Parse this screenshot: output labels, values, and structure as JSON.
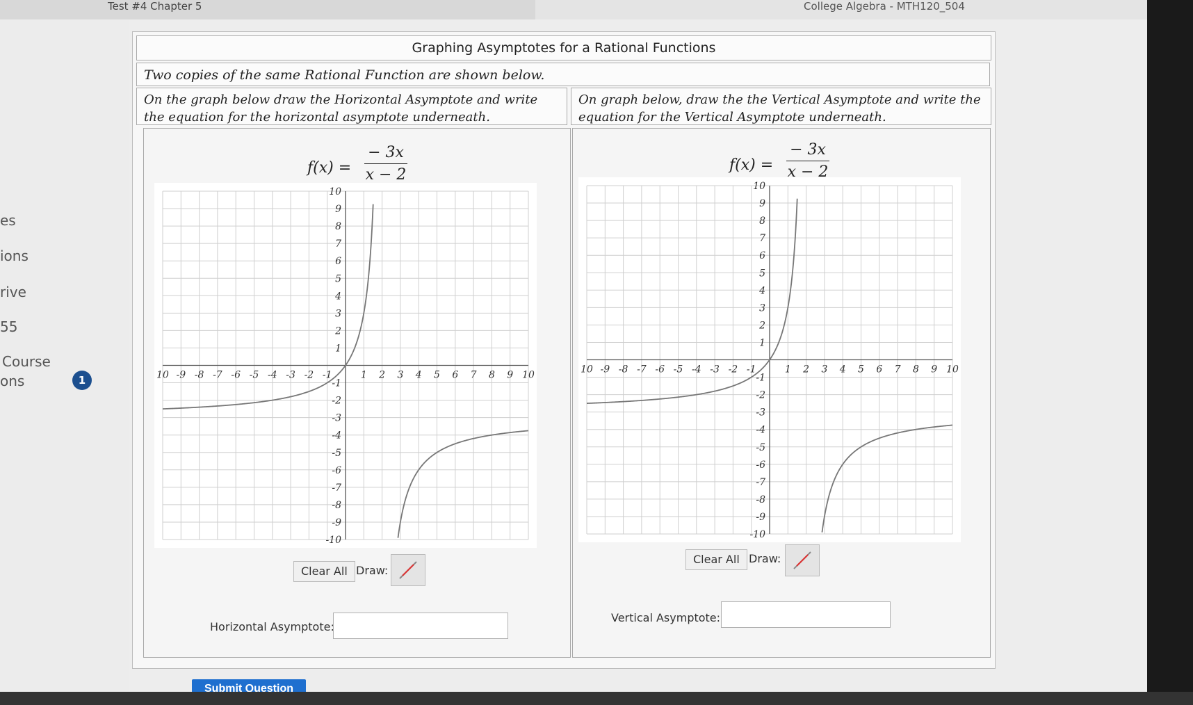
{
  "header": {
    "tab_title": "Test #4 Chapter 5",
    "course_title": "College Algebra - MTH120_504"
  },
  "sidebar": {
    "items": [
      "es",
      "ions",
      "rive",
      "55",
      "Course",
      "ons"
    ],
    "badge": "1"
  },
  "panel": {
    "title": "Graphing Asymptotes for a Rational Functions",
    "subtitle": "Two copies of the same Rational Function are shown below.",
    "left_instructions": "On the graph below draw the Horizontal Asymptote and write the equation for the horizontal asymptote underneath.",
    "right_instructions": "On graph below, draw the the Vertical Asymptote and write the equation for the Vertical Asymptote underneath.",
    "function_lhs": "f(x) =",
    "function_numerator": "− 3x",
    "function_denominator": "x − 2",
    "clear_label": "Clear All",
    "draw_label": "Draw:",
    "horizontal_label": "Horizontal Asymptote:",
    "vertical_label": "Vertical Asymptote:",
    "horizontal_value": "",
    "vertical_value": "",
    "submit_label": "Submit Question"
  },
  "chart_data": [
    {
      "type": "line",
      "function": "f(x) = -3x/(x-2)",
      "xlim": [
        -10,
        10
      ],
      "ylim": [
        -10,
        10
      ],
      "x_ticks": [
        "10",
        "-9",
        "-8",
        "-7",
        "-6",
        "-5",
        "-4",
        "-3",
        "-2",
        "-1",
        "1",
        "2",
        "3",
        "4",
        "5",
        "6",
        "7",
        "8",
        "9",
        "10"
      ],
      "y_ticks": [
        "10",
        "9",
        "8",
        "7",
        "6",
        "5",
        "4",
        "3",
        "2",
        "1",
        "-1",
        "-2",
        "-3",
        "-4",
        "-5",
        "-6",
        "-7",
        "-8",
        "-9",
        "-10"
      ],
      "grid": true,
      "xlabel": "",
      "ylabel": ""
    },
    {
      "type": "line",
      "function": "f(x) = -3x/(x-2)",
      "xlim": [
        -10,
        10
      ],
      "ylim": [
        -10,
        10
      ],
      "x_ticks": [
        "10",
        "-9",
        "-8",
        "-7",
        "-6",
        "-5",
        "-4",
        "-3",
        "-2",
        "-1",
        "1",
        "2",
        "3",
        "4",
        "5",
        "6",
        "7",
        "8",
        "9",
        "10"
      ],
      "y_ticks": [
        "10",
        "9",
        "8",
        "7",
        "6",
        "5",
        "4",
        "3",
        "2",
        "1",
        "-1",
        "-2",
        "-3",
        "-4",
        "-5",
        "-6",
        "-7",
        "-8",
        "-9",
        "-10"
      ],
      "grid": true,
      "xlabel": "",
      "ylabel": ""
    }
  ]
}
